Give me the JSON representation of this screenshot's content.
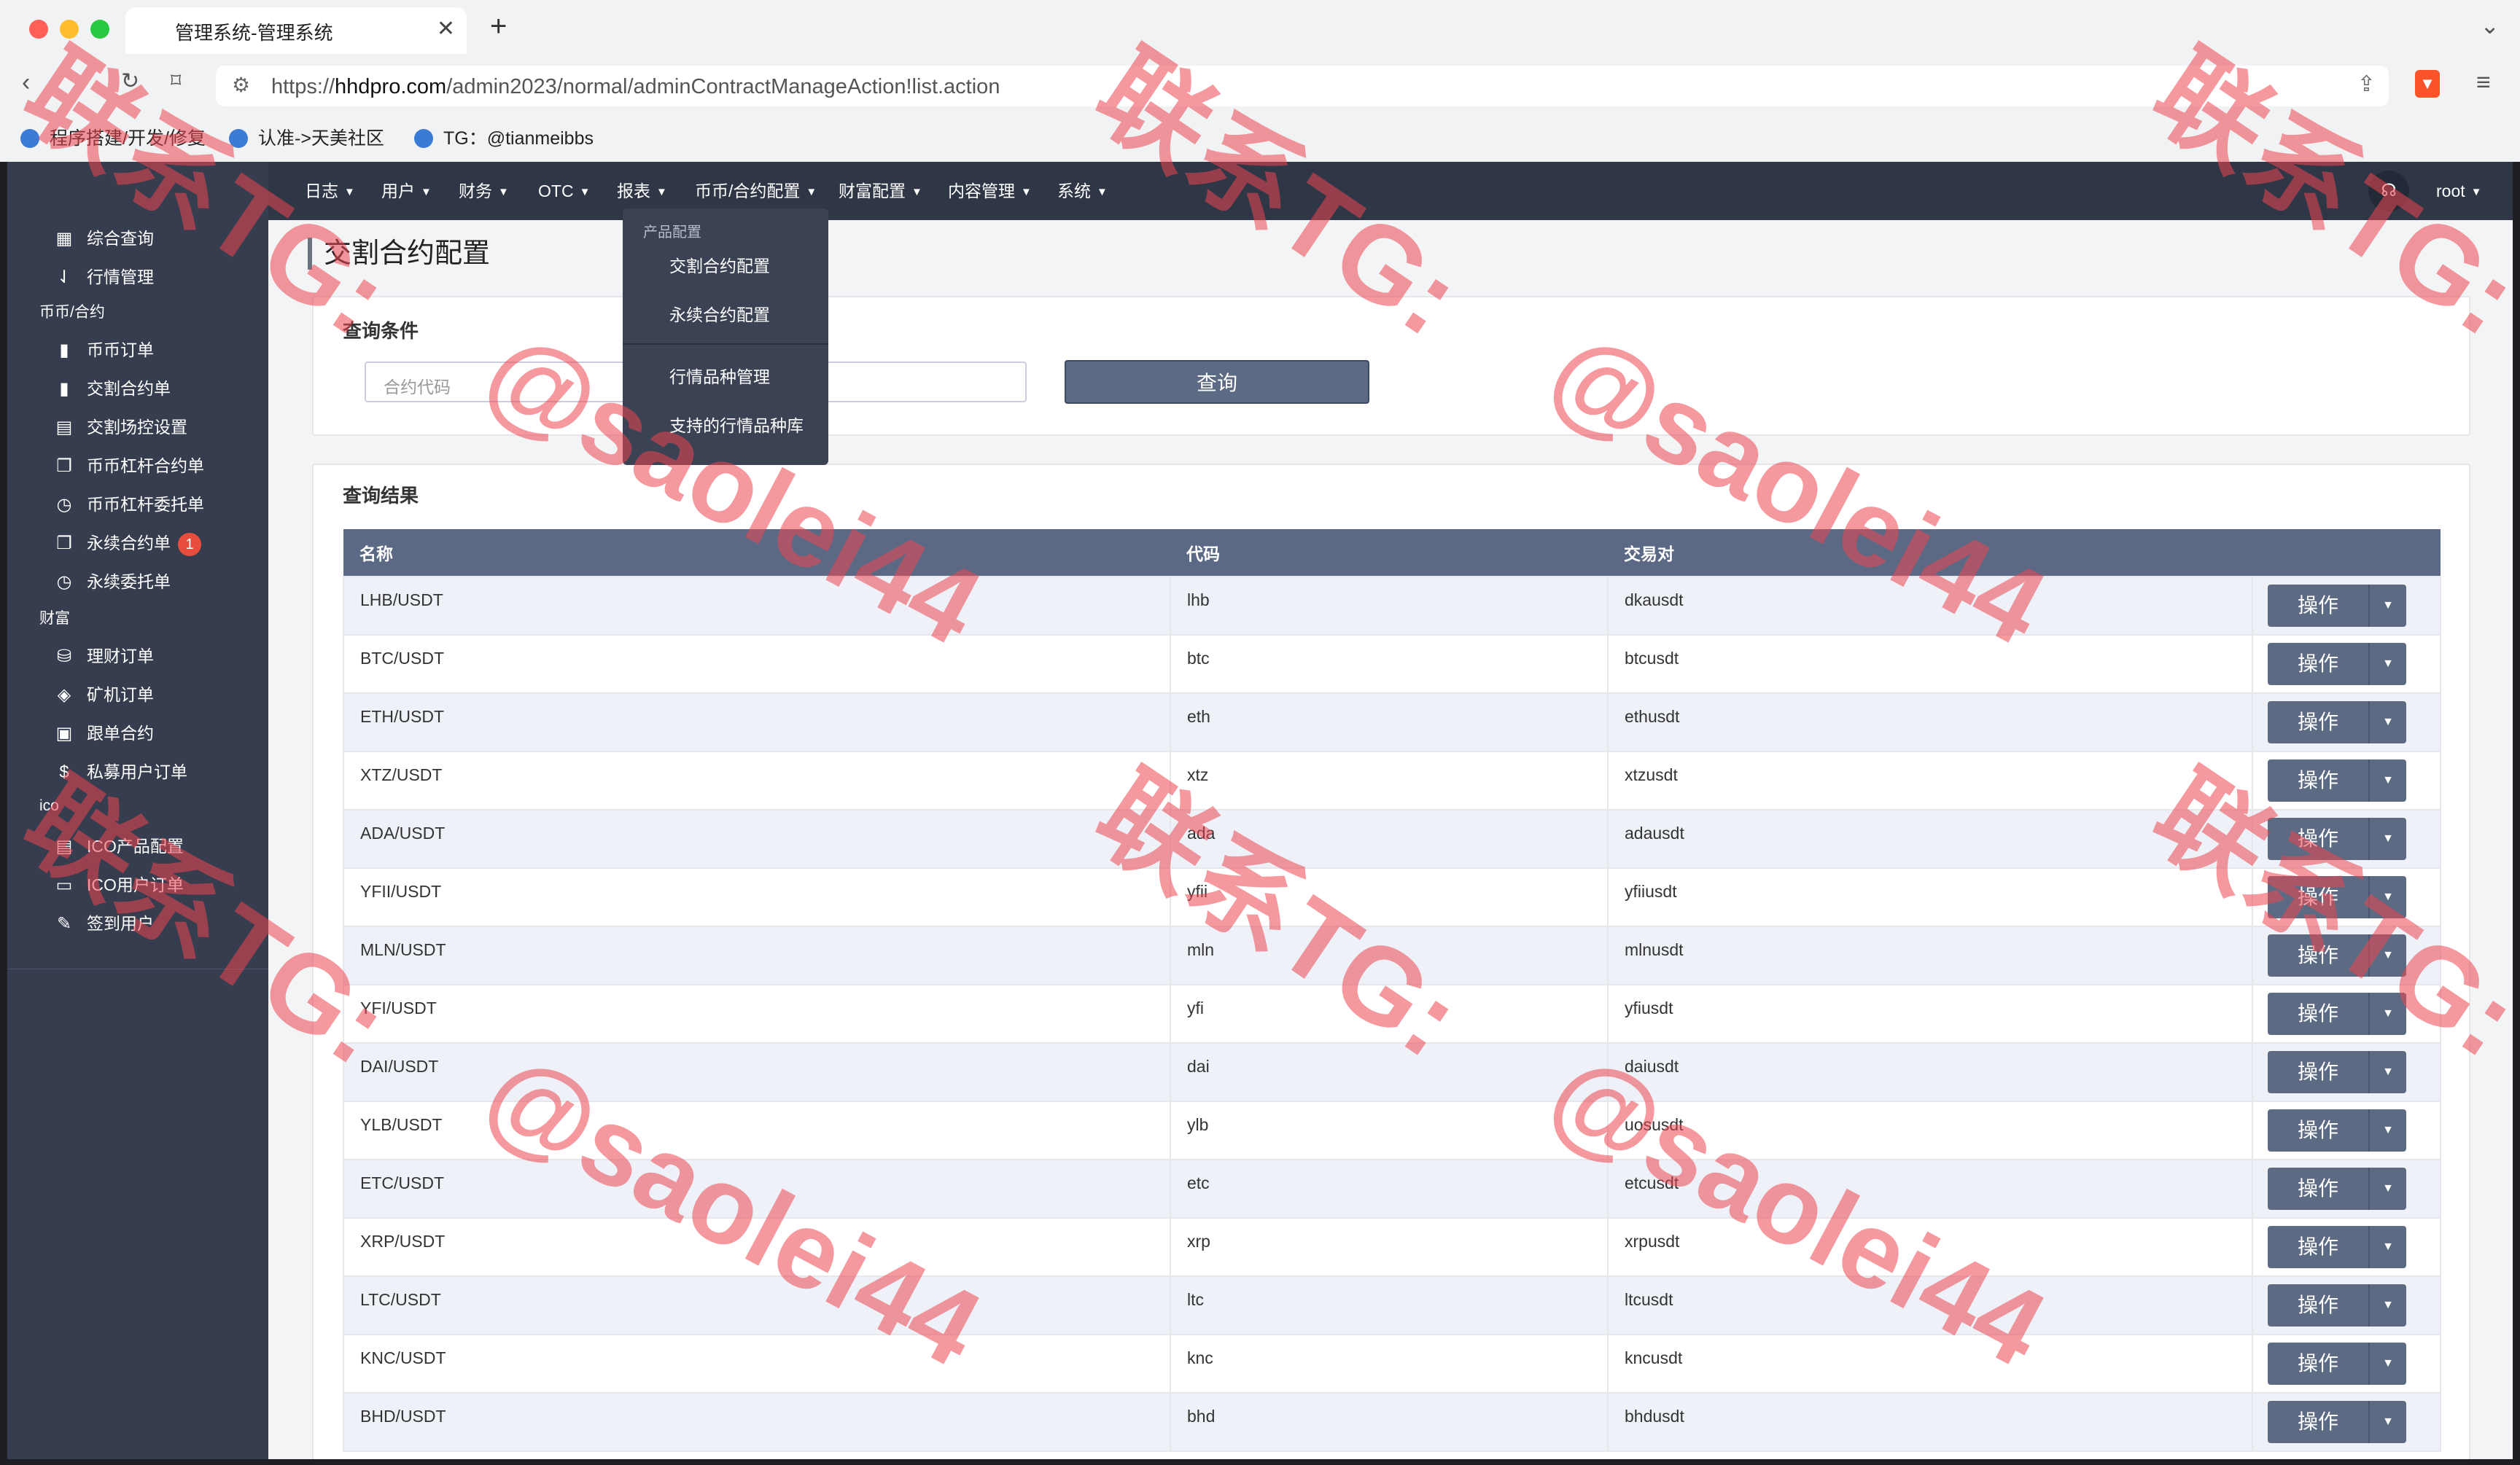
{
  "browser": {
    "tab_title": "管理系统-管理系统",
    "tab_close": "✕",
    "new_tab": "+",
    "url_prefix": "https://",
    "url_domain": "hhdpro.com",
    "url_path": "/admin2023/normal/adminContractManageAction!list.action",
    "bookmarks": [
      "程序搭建/开发/修复",
      "认准->天美社区",
      "TG：@tianmeibbs"
    ]
  },
  "sidebar": {
    "top_items": [
      {
        "label": "综合查询",
        "icon": "grid-icon"
      },
      {
        "label": "行情管理",
        "icon": "sort-icon"
      }
    ],
    "groups": [
      {
        "title": "币币/合约",
        "items": [
          {
            "label": "币币订单",
            "icon": "bookmark-icon"
          },
          {
            "label": "交割合约单",
            "icon": "bookmark-icon"
          },
          {
            "label": "交割场控设置",
            "icon": "clipboard-icon"
          },
          {
            "label": "币币杠杆合约单",
            "icon": "copy-icon"
          },
          {
            "label": "币币杠杆委托单",
            "icon": "clock-file-icon"
          },
          {
            "label": "永续合约单",
            "icon": "copy-icon",
            "badge": "1"
          },
          {
            "label": "永续委托单",
            "icon": "clock-file-icon"
          }
        ]
      },
      {
        "title": "财富",
        "items": [
          {
            "label": "理财订单",
            "icon": "coins-icon"
          },
          {
            "label": "矿机订单",
            "icon": "layers-icon"
          },
          {
            "label": "跟单合约",
            "icon": "calendar-icon"
          },
          {
            "label": "私募用户订单",
            "icon": "dollar-icon"
          }
        ]
      },
      {
        "title": "ico",
        "items": [
          {
            "label": "ICO产品配置",
            "icon": "file-icon"
          },
          {
            "label": "ICO用户订单",
            "icon": "monitor-icon"
          },
          {
            "label": "签到用户",
            "icon": "edit-icon"
          }
        ]
      }
    ]
  },
  "topnav": {
    "items": [
      "日志",
      "用户",
      "财务",
      "OTC",
      "报表",
      "币币/合约配置",
      "财富配置",
      "内容管理",
      "系统"
    ],
    "user": "root"
  },
  "dropdown": {
    "header": "产品配置",
    "items": [
      "交割合约配置",
      "永续合约配置",
      "行情品种管理",
      "支持的行情品种库"
    ]
  },
  "page": {
    "title": "交割合约配置",
    "query_title": "查询条件",
    "code_placeholder": "合约代码",
    "query_button": "查询",
    "result_title": "查询结果"
  },
  "table": {
    "headers": [
      "名称",
      "代码",
      "交易对",
      ""
    ],
    "op_label": "操作",
    "rows": [
      [
        "LHB/USDT",
        "lhb",
        "dkausdt"
      ],
      [
        "BTC/USDT",
        "btc",
        "btcusdt"
      ],
      [
        "ETH/USDT",
        "eth",
        "ethusdt"
      ],
      [
        "XTZ/USDT",
        "xtz",
        "xtzusdt"
      ],
      [
        "ADA/USDT",
        "ada",
        "adausdt"
      ],
      [
        "YFII/USDT",
        "yfii",
        "yfiiusdt"
      ],
      [
        "MLN/USDT",
        "mln",
        "mlnusdt"
      ],
      [
        "YFI/USDT",
        "yfi",
        "yfiusdt"
      ],
      [
        "DAI/USDT",
        "dai",
        "daiusdt"
      ],
      [
        "YLB/USDT",
        "ylb",
        "uosusdt"
      ],
      [
        "ETC/USDT",
        "etc",
        "etcusdt"
      ],
      [
        "XRP/USDT",
        "xrp",
        "xrpusdt"
      ],
      [
        "LTC/USDT",
        "ltc",
        "ltcusdt"
      ],
      [
        "KNC/USDT",
        "knc",
        "kncusdt"
      ],
      [
        "BHD/USDT",
        "bhd",
        "bhdusdt"
      ]
    ]
  },
  "watermark": {
    "line1": "联系TG:",
    "line2": "@saolei44"
  }
}
